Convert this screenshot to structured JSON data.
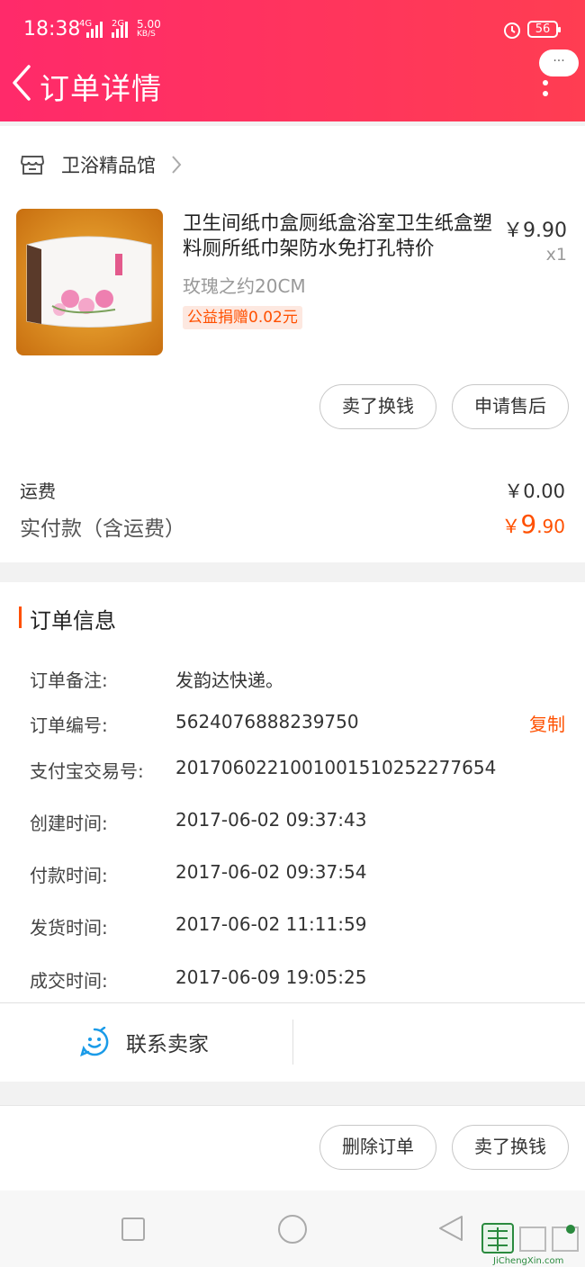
{
  "status_bar": {
    "time": "18:38",
    "net1": "4G",
    "net2": "2G",
    "speed_top": "5.00",
    "speed_unit": "KB/S",
    "battery": "56"
  },
  "nav": {
    "title": "订单详情",
    "more_label": "···"
  },
  "shop": {
    "name": "卫浴精品馆"
  },
  "product": {
    "title": "卫生间纸巾盒厕纸盒浴室卫生纸盒塑料厕所纸巾架防水免打孔特价",
    "price": "￥9.90",
    "qty": "x1",
    "spec": "玫瑰之约20CM",
    "charity": "公益捐赠0.02元"
  },
  "item_actions": {
    "sell_label": "卖了换钱",
    "after_sale_label": "申请售后"
  },
  "payment": {
    "freight_label": "运费",
    "freight_value": "￥0.00",
    "paid_label": "实付款（含运费）",
    "paid_currency": "￥",
    "paid_int": "9",
    "paid_dec": ".90"
  },
  "order_info": {
    "title": "订单信息",
    "copy_label": "复制",
    "rows": [
      {
        "label": "订单备注:",
        "value": "发韵达快递。"
      },
      {
        "label": "订单编号:",
        "value": "5624076888239750"
      },
      {
        "label": "支付宝交易号:",
        "value": "2017060221001001510252277654"
      },
      {
        "label": "创建时间:",
        "value": "2017-06-02 09:37:43"
      },
      {
        "label": "付款时间:",
        "value": "2017-06-02 09:37:54"
      },
      {
        "label": "发货时间:",
        "value": "2017-06-02 11:11:59"
      },
      {
        "label": "成交时间:",
        "value": "2017-06-09 19:05:25"
      }
    ]
  },
  "contact": {
    "label": "联系卖家"
  },
  "bottom_actions": {
    "delete_label": "删除订单",
    "sell_label": "卖了换钱"
  },
  "watermark": {
    "brand": "JiChengXin.com"
  },
  "colors": {
    "header_start": "#ff2a6a",
    "header_end": "#ff3d52",
    "accent": "#ff5000",
    "contact_icon": "#1a9be8"
  },
  "icons": [
    "back-arrow",
    "more-dots",
    "shop",
    "chevron-right",
    "smile-chat",
    "square",
    "circle",
    "triangle-back",
    "alarm"
  ]
}
